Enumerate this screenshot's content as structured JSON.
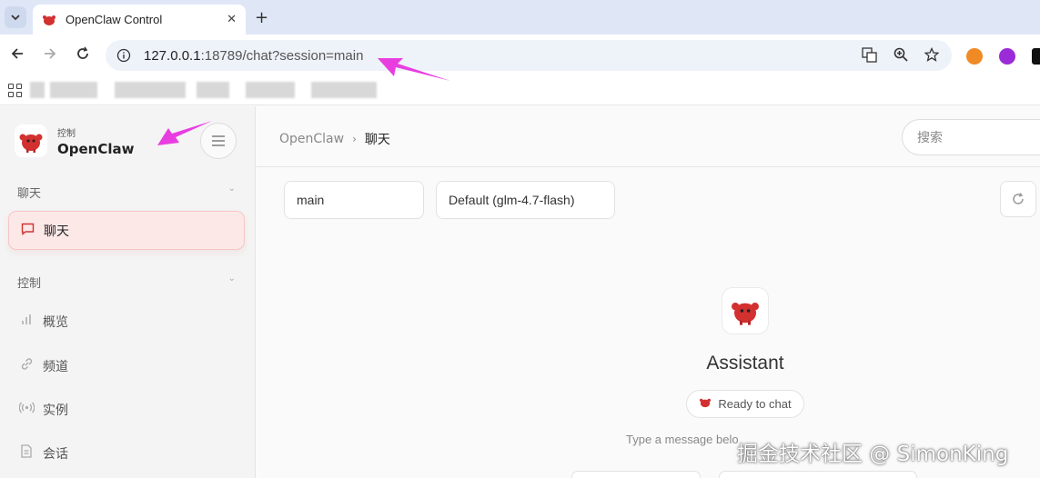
{
  "browser": {
    "tab_title": "OpenClaw Control",
    "tab_close": "✕",
    "new_tab": "+",
    "url_host": "127.0.0.1",
    "url_rest": ":18789/chat?session=main"
  },
  "sidebar": {
    "brand_sub": "控制",
    "brand_title": "OpenClaw",
    "sections": [
      {
        "label": "聊天"
      },
      {
        "label": "控制"
      }
    ],
    "items": [
      {
        "label": "聊天"
      },
      {
        "label": "概览"
      },
      {
        "label": "频道"
      },
      {
        "label": "实例"
      },
      {
        "label": "会话"
      }
    ]
  },
  "header": {
    "crumb_root": "OpenClaw",
    "crumb_sep": "›",
    "crumb_current": "聊天",
    "search_placeholder": "搜索"
  },
  "chat": {
    "session_value": "main",
    "model_value": "Default (glm-4.7-flash)",
    "assistant_name": "Assistant",
    "status": "Ready to chat",
    "hint": "Type a message belo"
  },
  "watermark": "掘金技术社区 @ SimonKing",
  "colors": {
    "accent": "#d33030",
    "annotation": "#e83ee0",
    "active_bg": "#fde8e8"
  },
  "icons": {
    "chat": "chat-bubble-icon",
    "overview": "bar-chart-icon",
    "channels": "link-icon",
    "instances": "radio-signal-icon",
    "sessions": "document-icon"
  }
}
